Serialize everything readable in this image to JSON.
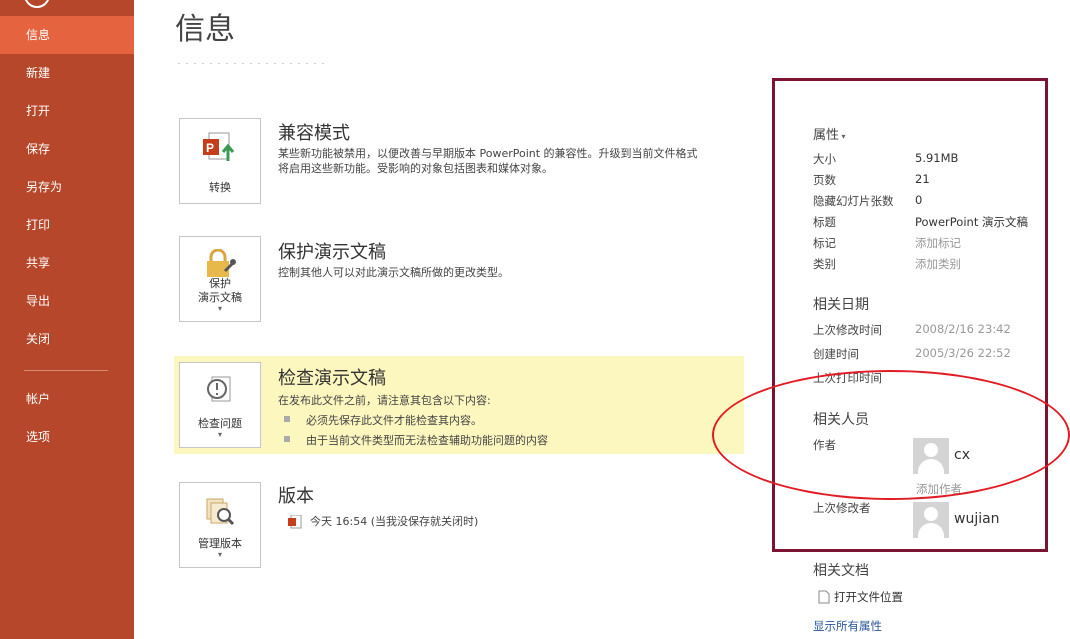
{
  "sidebar": {
    "items": [
      {
        "label": "信息",
        "active": true
      },
      {
        "label": "新建"
      },
      {
        "label": "打开"
      },
      {
        "label": "保存"
      },
      {
        "label": "另存为"
      },
      {
        "label": "打印"
      },
      {
        "label": "共享"
      },
      {
        "label": "导出"
      },
      {
        "label": "关闭"
      },
      {
        "label": "帐户"
      },
      {
        "label": "选项"
      }
    ]
  },
  "main": {
    "title": "信息",
    "compat": {
      "button": "转换",
      "title": "兼容模式",
      "desc1": "某些新功能被禁用，以便改善与早期版本 PowerPoint 的兼容性。升级到当前文件格式",
      "desc2": "将启用这些新功能。受影响的对象包括图表和媒体对象。"
    },
    "protect": {
      "button_line1": "保护",
      "button_line2": "演示文稿",
      "title": "保护演示文稿",
      "desc": "控制其他人可以对此演示文稿所做的更改类型。"
    },
    "inspect": {
      "button": "检查问题",
      "title": "检查演示文稿",
      "desc": "在发布此文件之前，请注意其包含以下内容:",
      "bullets": [
        "必须先保存此文件才能检查其内容。",
        "由于当前文件类型而无法检查辅助功能问题的内容"
      ]
    },
    "versions": {
      "button": "管理版本",
      "title": "版本",
      "entry": "今天 16:54 (当我没保存就关闭时)"
    }
  },
  "properties": {
    "header": "属性",
    "rows": [
      {
        "label": "大小",
        "value": "5.91MB"
      },
      {
        "label": "页数",
        "value": "21"
      },
      {
        "label": "隐藏幻灯片张数",
        "value": "0"
      },
      {
        "label": "标题",
        "value": "PowerPoint 演示文稿"
      },
      {
        "label": "标记",
        "value": "添加标记"
      },
      {
        "label": "类别",
        "value": "添加类别"
      }
    ],
    "dates_header": "相关日期",
    "dates": [
      {
        "label": "上次修改时间",
        "value": "2008/2/16 23:42"
      },
      {
        "label": "创建时间",
        "value": "2005/3/26 22:52"
      },
      {
        "label": "上次打印时间",
        "value": ""
      }
    ],
    "people_header": "相关人员",
    "author_label": "作者",
    "author_name": "cx",
    "add_author": "添加作者",
    "modifier_label": "上次修改者",
    "modifier_name": "wujian",
    "docs_header": "相关文档",
    "open_location": "打开文件位置",
    "show_all": "显示所有属性"
  },
  "colors": {
    "sidebar": "#b7472a",
    "sidebar_active": "#e5633f",
    "frame": "#7a1430",
    "annotation": "#e21c24",
    "highlight": "#fcf6bf"
  }
}
